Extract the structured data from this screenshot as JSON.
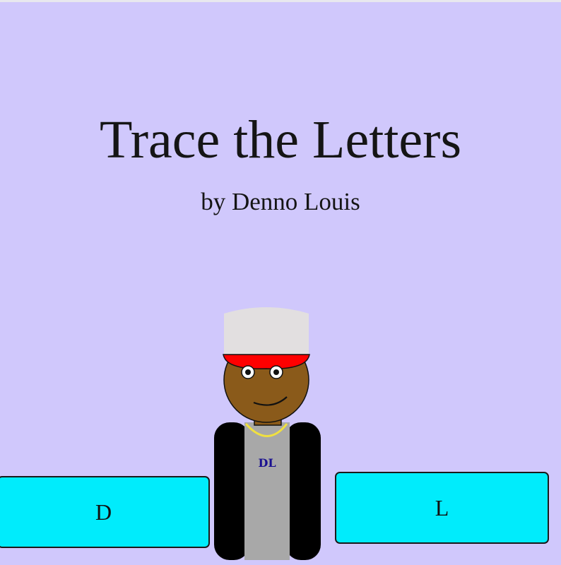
{
  "title": "Trace the Letters",
  "byline": "by Denno Louis",
  "buttons": {
    "left_label": "D",
    "right_label": "L"
  },
  "character": {
    "shirt_text": "DL"
  },
  "colors": {
    "background": "#d0c8fc",
    "button_fill": "#00ecfc",
    "cap_crown": "#e2dfe0",
    "cap_brim": "#ff0000",
    "skin": "#8a5a1a",
    "shirt": "#a8a8a8",
    "jacket": "#000000",
    "necklace": "#f0e040",
    "shirt_text": "#1a1090"
  }
}
